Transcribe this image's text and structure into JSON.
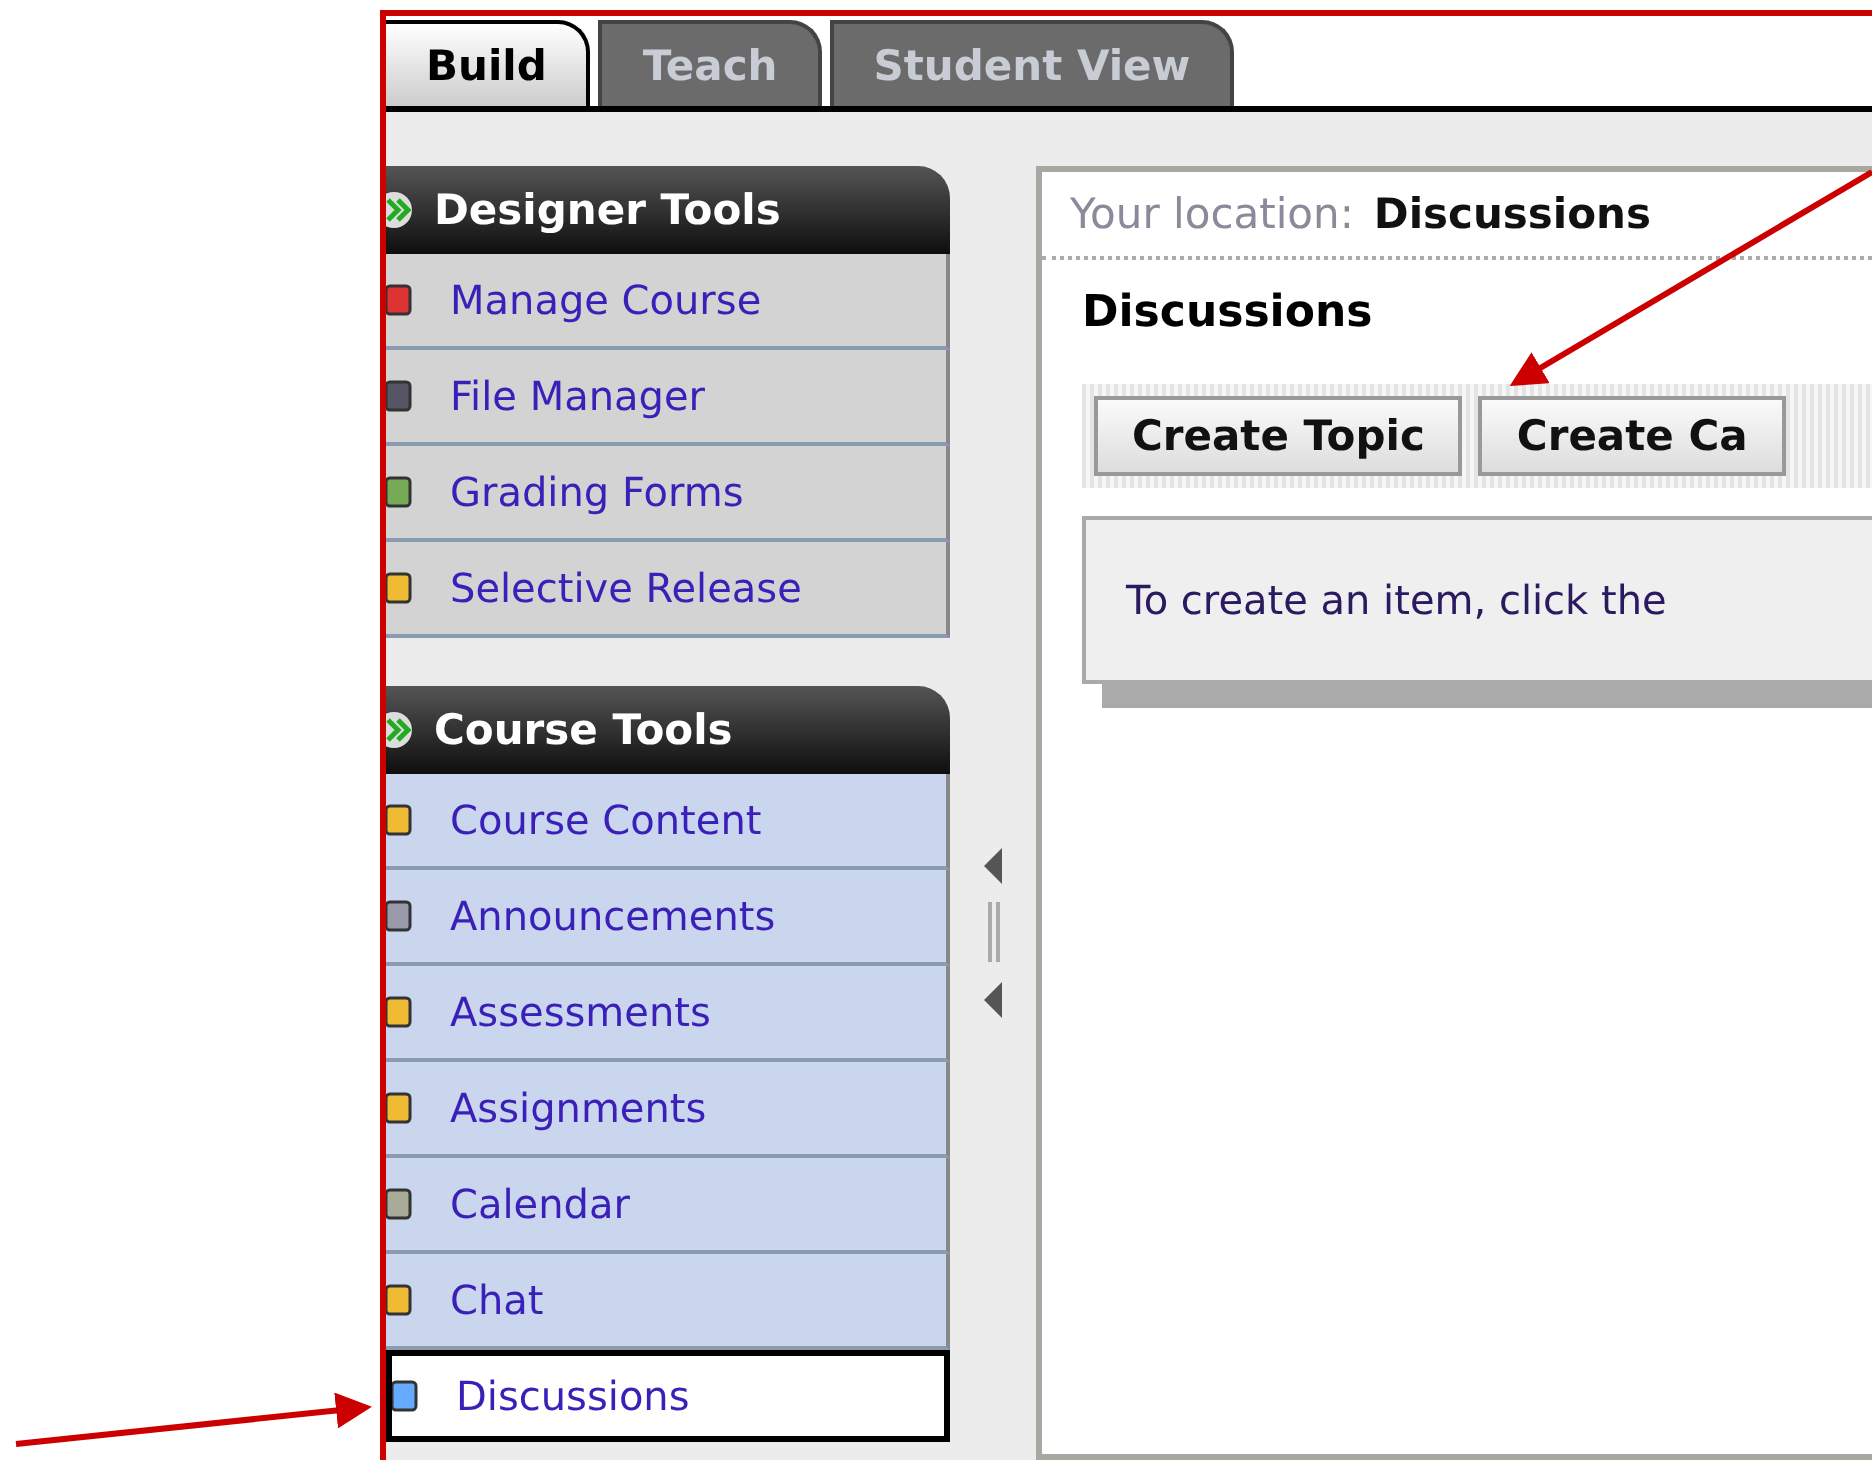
{
  "tabs": [
    {
      "label": "Build",
      "selected": true
    },
    {
      "label": "Teach",
      "selected": false
    },
    {
      "label": "Student View",
      "selected": false
    }
  ],
  "sidebar": {
    "sections": [
      {
        "title": "Designer Tools",
        "kind": "designer",
        "items": [
          {
            "label": "Manage Course",
            "selected": false
          },
          {
            "label": "File Manager",
            "selected": false
          },
          {
            "label": "Grading Forms",
            "selected": false
          },
          {
            "label": "Selective Release",
            "selected": false
          }
        ]
      },
      {
        "title": "Course Tools",
        "kind": "course",
        "items": [
          {
            "label": "Course Content",
            "selected": false
          },
          {
            "label": "Announcements",
            "selected": false
          },
          {
            "label": "Assessments",
            "selected": false
          },
          {
            "label": "Assignments",
            "selected": false
          },
          {
            "label": "Calendar",
            "selected": false
          },
          {
            "label": "Chat",
            "selected": false
          },
          {
            "label": "Discussions",
            "selected": true
          }
        ]
      }
    ]
  },
  "content": {
    "location_label": "Your location:",
    "location_value": "Discussions",
    "heading": "Discussions",
    "buttons": [
      "Create Topic",
      "Create Ca"
    ],
    "message": "To create an item, click the"
  }
}
